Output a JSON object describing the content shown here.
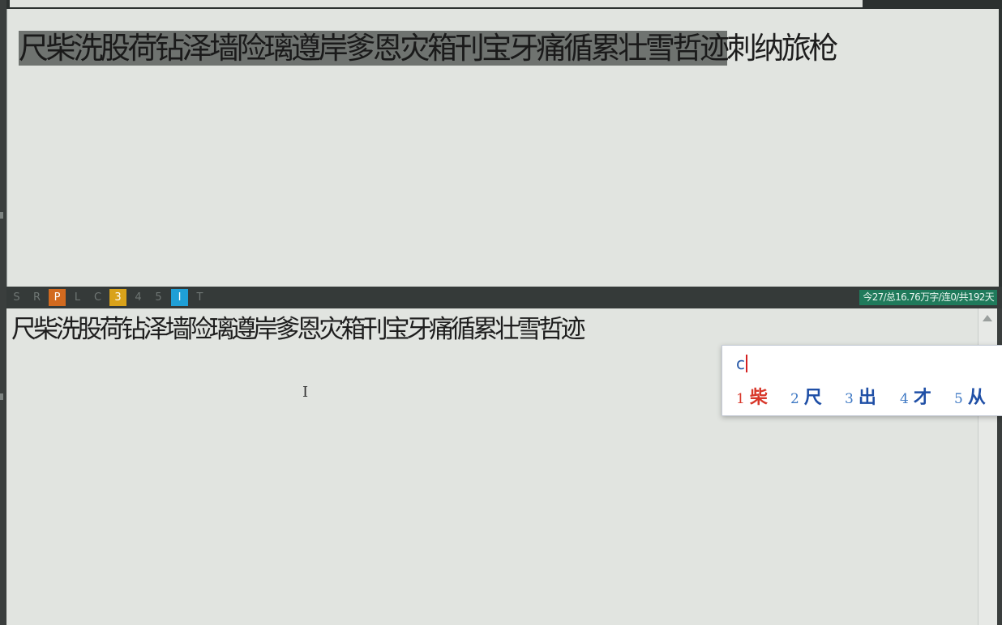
{
  "reference": {
    "typed": "尺柴洗股荷钻泽墙险璃遵岸爹恩灾箱刊宝牙痛循累壮雪哲迹",
    "remaining": "刺纳旅枪"
  },
  "status_bar": {
    "modes": [
      {
        "label": "S",
        "state": "off"
      },
      {
        "label": "R",
        "state": "off"
      },
      {
        "label": "P",
        "state": "orange"
      },
      {
        "label": "L",
        "state": "off"
      },
      {
        "label": "C",
        "state": "off"
      },
      {
        "label": "3",
        "state": "yellow"
      },
      {
        "label": "4",
        "state": "off"
      },
      {
        "label": "5",
        "state": "off"
      },
      {
        "label": "I",
        "state": "blue"
      },
      {
        "label": "T",
        "state": "off"
      }
    ],
    "stats": "今27/总16.76万字/连0/共192天"
  },
  "typing": {
    "text": "尺柴洗股荷钻泽墙险璃遵岸爹恩灾箱刊宝牙痛循累壮雪哲迹"
  },
  "ime": {
    "input": "c",
    "candidates": [
      {
        "num": "1",
        "char": "柴"
      },
      {
        "num": "2",
        "char": "尺"
      },
      {
        "num": "3",
        "char": "出"
      },
      {
        "num": "4",
        "char": "才"
      },
      {
        "num": "5",
        "char": "从"
      }
    ],
    "selected_index": 0
  },
  "colors": {
    "panel_bg": "#e1e4e0",
    "typed_highlight": "#6f7370",
    "stats_bg": "#1f7a5b",
    "candidate_selected": "#d8372a",
    "candidate_normal": "#1f4fa6"
  }
}
